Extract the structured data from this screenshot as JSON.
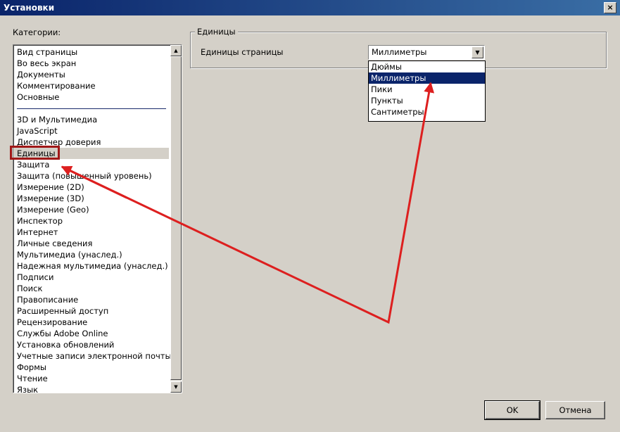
{
  "window": {
    "title": "Установки",
    "close_glyph": "×"
  },
  "categories": {
    "label": "Категории:",
    "group1": [
      "Вид страницы",
      "Во весь экран",
      "Документы",
      "Комментирование",
      "Основные"
    ],
    "group2": [
      "3D и Мультимедиа",
      "JavaScript",
      "Диспетчер доверия"
    ],
    "selected": "Единицы",
    "group3": [
      "Защита",
      "Защита (повышенный уровень)",
      "Измерение (2D)",
      "Измерение (3D)",
      "Измерение (Geo)",
      "Инспектор",
      "Интернет",
      "Личные сведения",
      "Мультимедиа (унаслед.)",
      "Надежная мультимедиа (унаслед.)",
      "Подписи",
      "Поиск",
      "Правописание",
      "Расширенный доступ",
      "Рецензирование",
      "Службы Adobe Online",
      "Установка обновлений",
      "Учетные записи электронной почты",
      "Формы",
      "Чтение",
      "Язык"
    ]
  },
  "units_group": {
    "legend": "Единицы",
    "label": "Единицы страницы",
    "combo_value": "Миллиметры",
    "options": [
      "Дюймы",
      "Миллиметры",
      "Пики",
      "Пункты",
      "Сантиметры"
    ],
    "selected_option": "Миллиметры"
  },
  "buttons": {
    "ok": "OK",
    "cancel": "Отмена"
  },
  "icons": {
    "scroll_up": "scroll-up-arrow-icon",
    "scroll_down": "scroll-down-arrow-icon",
    "combo": "chevron-down-icon"
  },
  "annotation_color": "#dd1f1f"
}
